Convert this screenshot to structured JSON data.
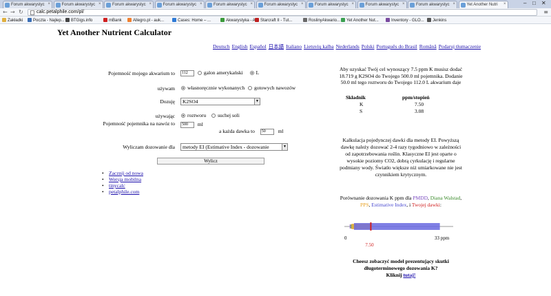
{
  "browser": {
    "tabs": [
      "Forum akwarystyc",
      "Forum akwarystyc",
      "Forum akwarystyc",
      "Forum akwarystyc",
      "Forum akwarystyc",
      "Forum akwarystyc",
      "Forum akwarystyc",
      "Forum akwarystyc",
      "Forum akwarystyc",
      "Yet Another Nutri"
    ],
    "url": "calc.petalphile.com/pl/",
    "bookmarks": [
      {
        "label": "Zakładki",
        "color": "#e0b040"
      },
      {
        "label": "Poczta - Najlep...",
        "color": "#3b6fb6"
      },
      {
        "label": "BTGigs.info",
        "color": "#444444"
      },
      {
        "label": "mBank",
        "color": "#d02020"
      },
      {
        "label": "Allegro.pl - auk...",
        "color": "#f08030"
      },
      {
        "label": "Cases: Home – ...",
        "color": "#2f7bd6"
      },
      {
        "label": "Akwarystyka - A...",
        "color": "#3a9a3a"
      },
      {
        "label": "Starcraft II - Tut...",
        "color": "#c02020"
      },
      {
        "label": "RoslinyAkwario...",
        "color": "#6a6a6a"
      },
      {
        "label": "Yet Another Nut...",
        "color": "#3aa050"
      },
      {
        "label": "Inventory - GLO...",
        "color": "#7a4aa0"
      },
      {
        "label": "Jenkins",
        "color": "#555555"
      }
    ]
  },
  "page": {
    "title": "Yet Another Nutrient Calculator",
    "languages": [
      "Deutsch",
      "English",
      "Español",
      "日本語",
      "Italiano",
      "Lietuvių kalba",
      "Nederlands",
      "Polski",
      "Português do Brasil",
      "Română",
      "Podaruj tłumaczenie"
    ]
  },
  "form": {
    "tank_label": "Pojemność mojego akwarium to",
    "tank_value": "112",
    "unit_gallon": "galon amerykański",
    "unit_liter": "L",
    "using_label": "używam",
    "opt_diy": "własnoręcznie wykonanych",
    "opt_ready": "gotowych nawozów",
    "dose_label": "Dozuję",
    "compound": "K2SO4",
    "using2_label": "używając",
    "opt_solution": "roztworu",
    "opt_dry": "suchej soli",
    "container_label": "Pojemność pojemnika na nawóz to",
    "container_value": "500",
    "container_unit": "ml",
    "dose_each_label": "a każda dawka to",
    "dose_each_value": "50",
    "dose_each_unit": "ml",
    "method_label": "Wyliczam dozowanie dla",
    "method_value": "metody EI (Estimative Index - dozowanie",
    "submit": "Wylicz"
  },
  "links": [
    "Zacznij od nowa",
    "Wersja mobilna",
    "tinycalc",
    "petalphile.com"
  ],
  "result": {
    "text": "Aby uzyskać Twój cel wynoszący 7.5 ppm K musisz dodać 18.719 g K2SO4 do Twojego 500.0 ml pojemnika. Dodanie 50.0 ml tego roztworu do Twojego 112.0 L akwarium daje",
    "col_component": "Składnik",
    "col_ppm": "ppm/stopień",
    "rows": [
      {
        "component": "K",
        "ppm": "7.50"
      },
      {
        "component": "S",
        "ppm": "3.08"
      }
    ]
  },
  "ei_text": "Kalkulacja pojedynczej dawki dla metody EI. Powyższą dawkę należy dozować 2-4 razy tygodniowo w zależności od zapotrzebowania roślin. Klasyczne EI jest oparte o wysokie poziomy CO2, dobrą cyrkulację i regularne podmiany wody. Światło większe niż umiarkowane nie jest czynnikiem krytycznym.",
  "comparison": {
    "intro": "Porównanie dozowania K ppm dla",
    "pmdd": "PMDD",
    "sep1": ",",
    "walstad": "Diana Walstad",
    "sep2": ",",
    "pps": "PPS",
    "sep3": ",",
    "ei": "Estimative Index",
    "sep4": ", i",
    "yours": "Twojej dawki",
    "end": ":",
    "axis_min": "0",
    "axis_max": "33 ppm",
    "your_value": "7.50",
    "scale_max": 33,
    "ranges": [
      {
        "name": "PMDD",
        "from": 0.6,
        "to": 2.5,
        "color": "#8a6fc4"
      },
      {
        "name": "Walstad",
        "from": 1.0,
        "to": 3.0,
        "color": "#6aae3a"
      },
      {
        "name": "PPS",
        "from": 1.2,
        "to": 7.5,
        "color": "#f0b040"
      },
      {
        "name": "EI",
        "from": 2.0,
        "to": 30.0,
        "color": "#6a6ae0"
      },
      {
        "name": "Yours",
        "from": 7.5,
        "to": 7.5,
        "color": "#d02020"
      }
    ]
  },
  "cheesz": {
    "line1": "Cheesz zobaczyć model prezentujący skutki długoterminowego dozowania K?",
    "line2": "Kliknij",
    "link": "tutaj!"
  }
}
